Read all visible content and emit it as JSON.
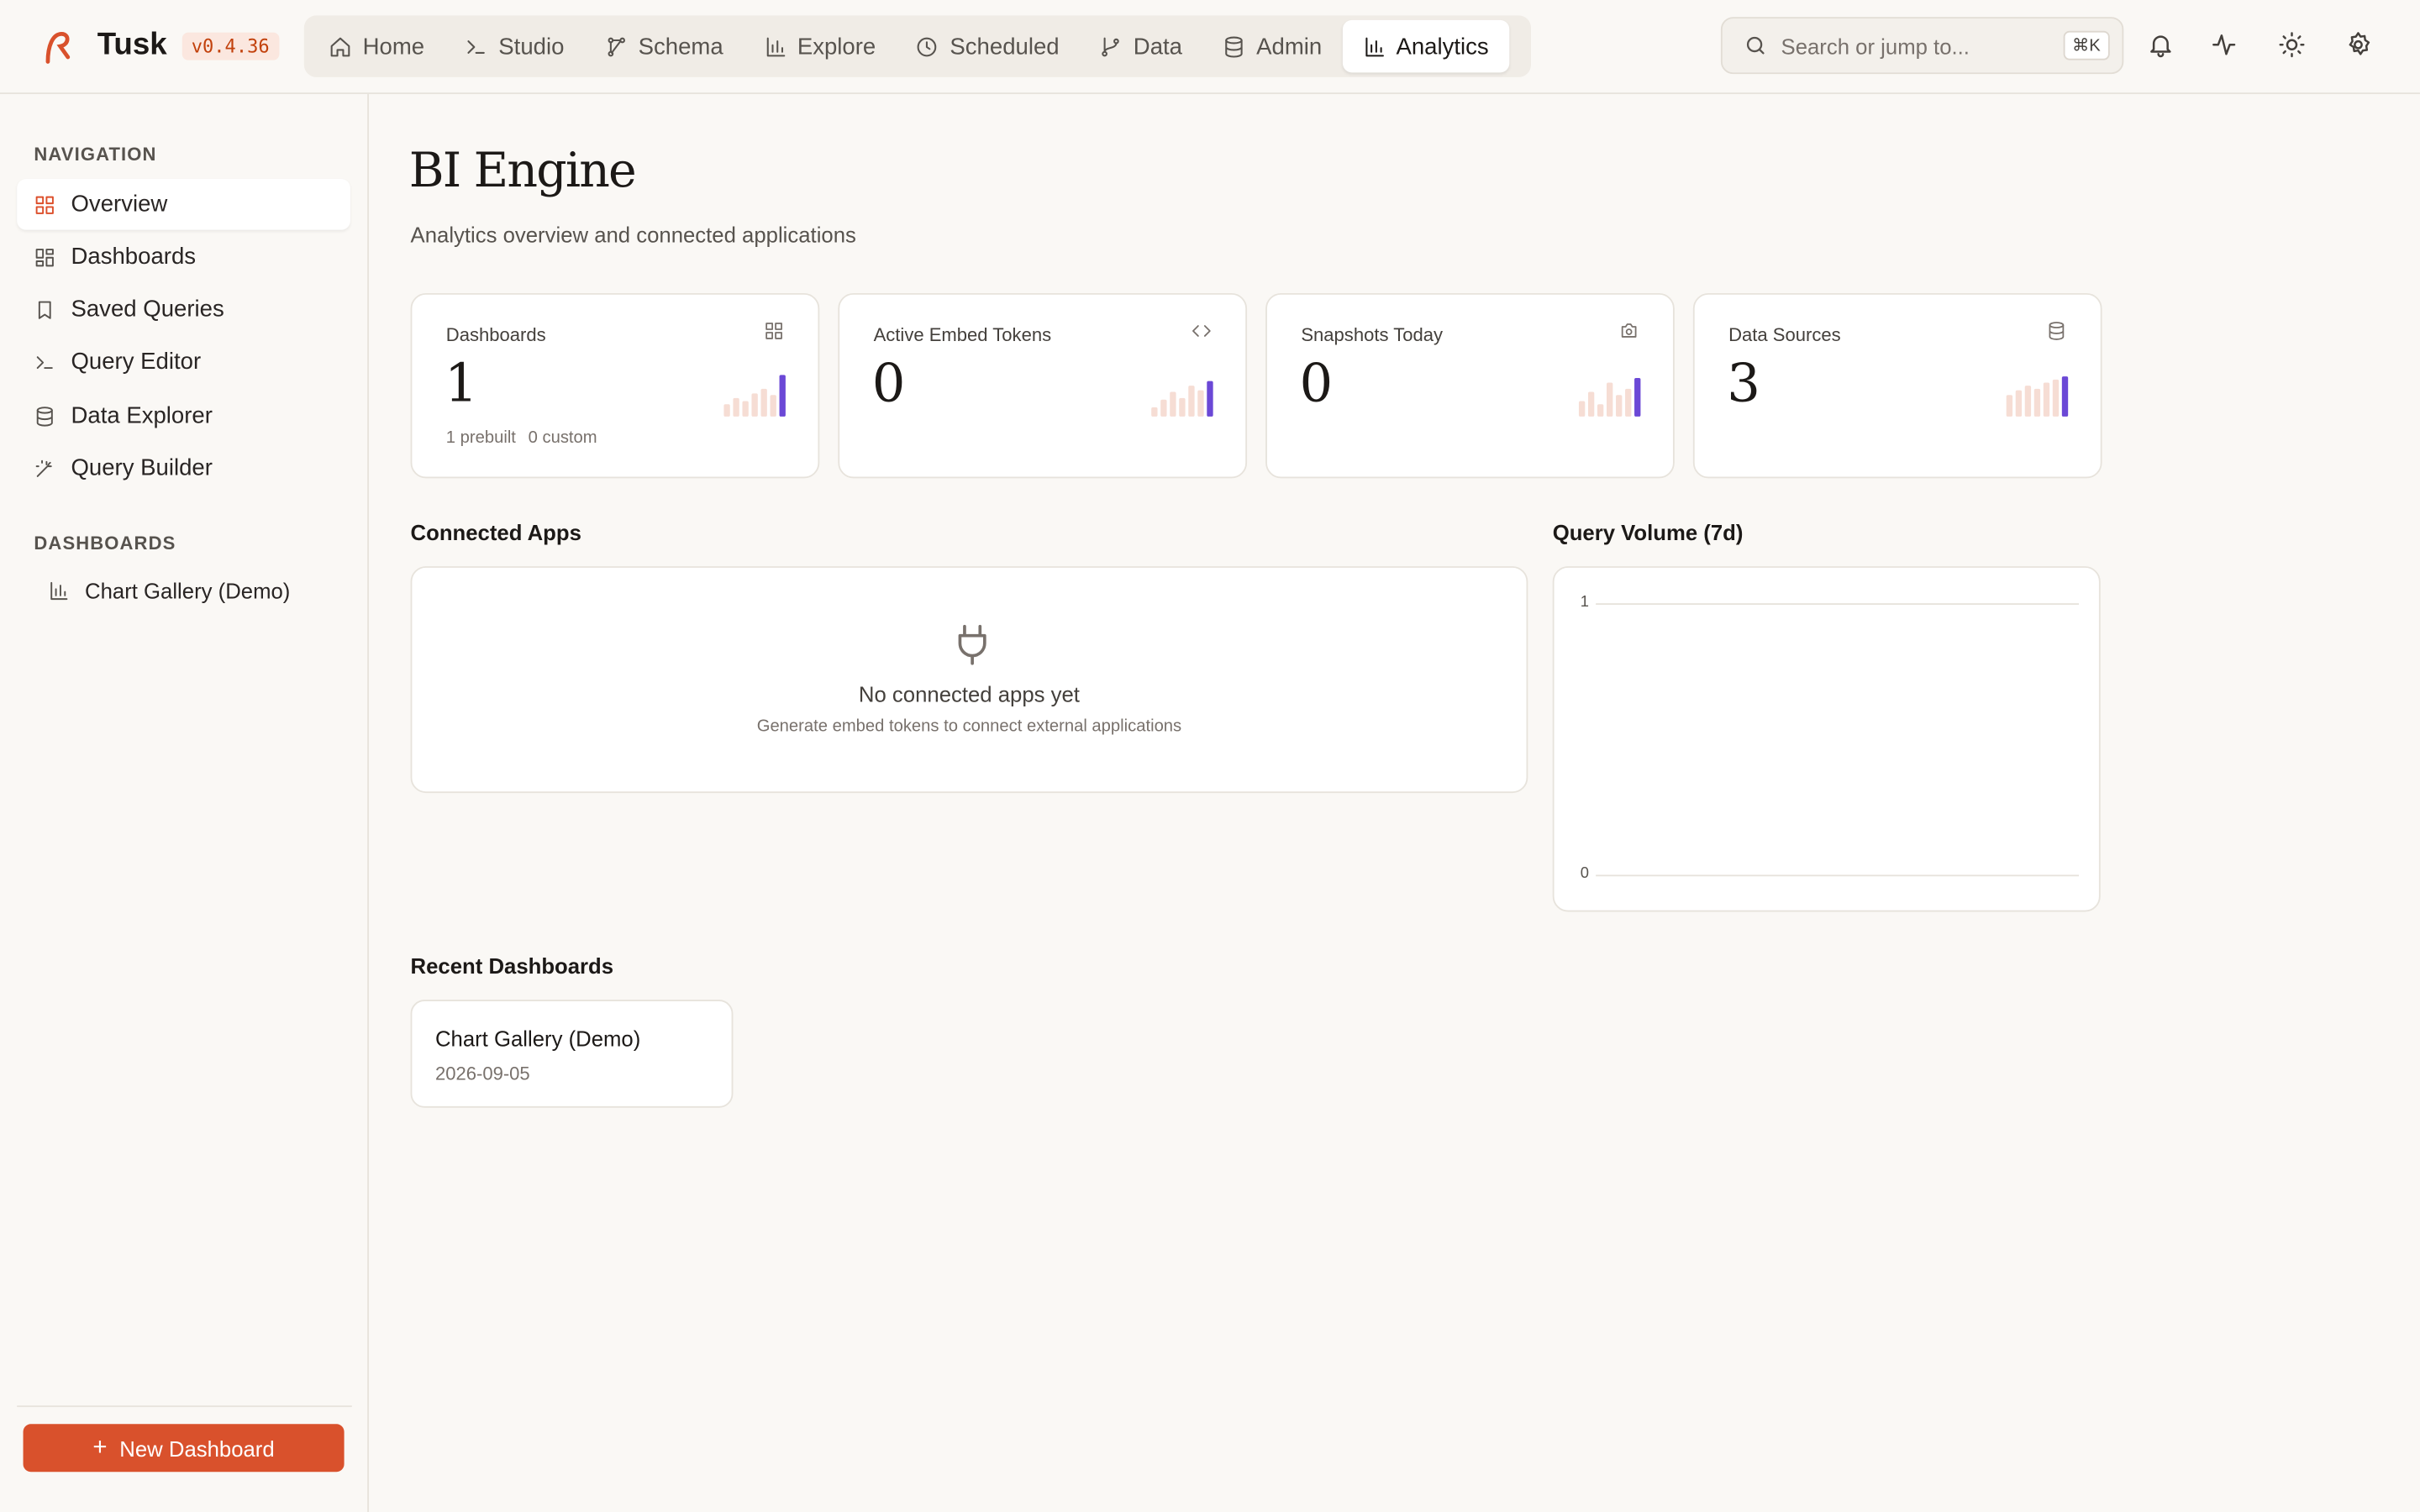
{
  "app": {
    "name": "Tusk",
    "version": "v0.4.36",
    "accent": "#d9512c"
  },
  "nav": {
    "tabs": [
      {
        "label": "Home",
        "icon": "home-icon"
      },
      {
        "label": "Studio",
        "icon": "terminal-icon"
      },
      {
        "label": "Schema",
        "icon": "schema-icon"
      },
      {
        "label": "Explore",
        "icon": "bar-chart-icon"
      },
      {
        "label": "Scheduled",
        "icon": "clock-icon"
      },
      {
        "label": "Data",
        "icon": "git-branch-icon"
      },
      {
        "label": "Admin",
        "icon": "database-icon"
      },
      {
        "label": "Analytics",
        "icon": "bar-chart-icon",
        "active": true
      }
    ]
  },
  "search": {
    "placeholder": "Search or jump to...",
    "shortcut": "⌘K"
  },
  "sidebar": {
    "nav_heading": "NAVIGATION",
    "items": [
      {
        "label": "Overview",
        "icon": "grid-icon",
        "active": true
      },
      {
        "label": "Dashboards",
        "icon": "dashboard-icon"
      },
      {
        "label": "Saved Queries",
        "icon": "bookmark-icon"
      },
      {
        "label": "Query Editor",
        "icon": "terminal-icon"
      },
      {
        "label": "Data Explorer",
        "icon": "database-icon"
      },
      {
        "label": "Query Builder",
        "icon": "wand-icon"
      }
    ],
    "dash_heading": "DASHBOARDS",
    "dashboards": [
      {
        "label": "Chart Gallery (Demo)",
        "icon": "bar-chart-icon"
      }
    ],
    "new_button": "New Dashboard"
  },
  "page": {
    "title": "BI Engine",
    "subtitle": "Analytics overview and connected applications"
  },
  "stats": [
    {
      "label": "Dashboards",
      "value": "1",
      "foot": [
        "1 prebuilt",
        "0 custom"
      ],
      "icon": "dashboard-icon"
    },
    {
      "label": "Active Embed Tokens",
      "value": "0",
      "foot": [],
      "icon": "code-icon"
    },
    {
      "label": "Snapshots Today",
      "value": "0",
      "foot": [],
      "icon": "camera-icon"
    },
    {
      "label": "Data Sources",
      "value": "3",
      "foot": [],
      "icon": "database-icon"
    }
  ],
  "connected_apps": {
    "title": "Connected Apps",
    "empty_title": "No connected apps yet",
    "empty_sub": "Generate embed tokens to connect external applications"
  },
  "query_volume": {
    "title": "Query Volume (7d)",
    "y_top": "1",
    "y_bottom": "0"
  },
  "recent": {
    "title": "Recent Dashboards",
    "items": [
      {
        "title": "Chart Gallery (Demo)",
        "date": "2026-09-05"
      }
    ]
  }
}
